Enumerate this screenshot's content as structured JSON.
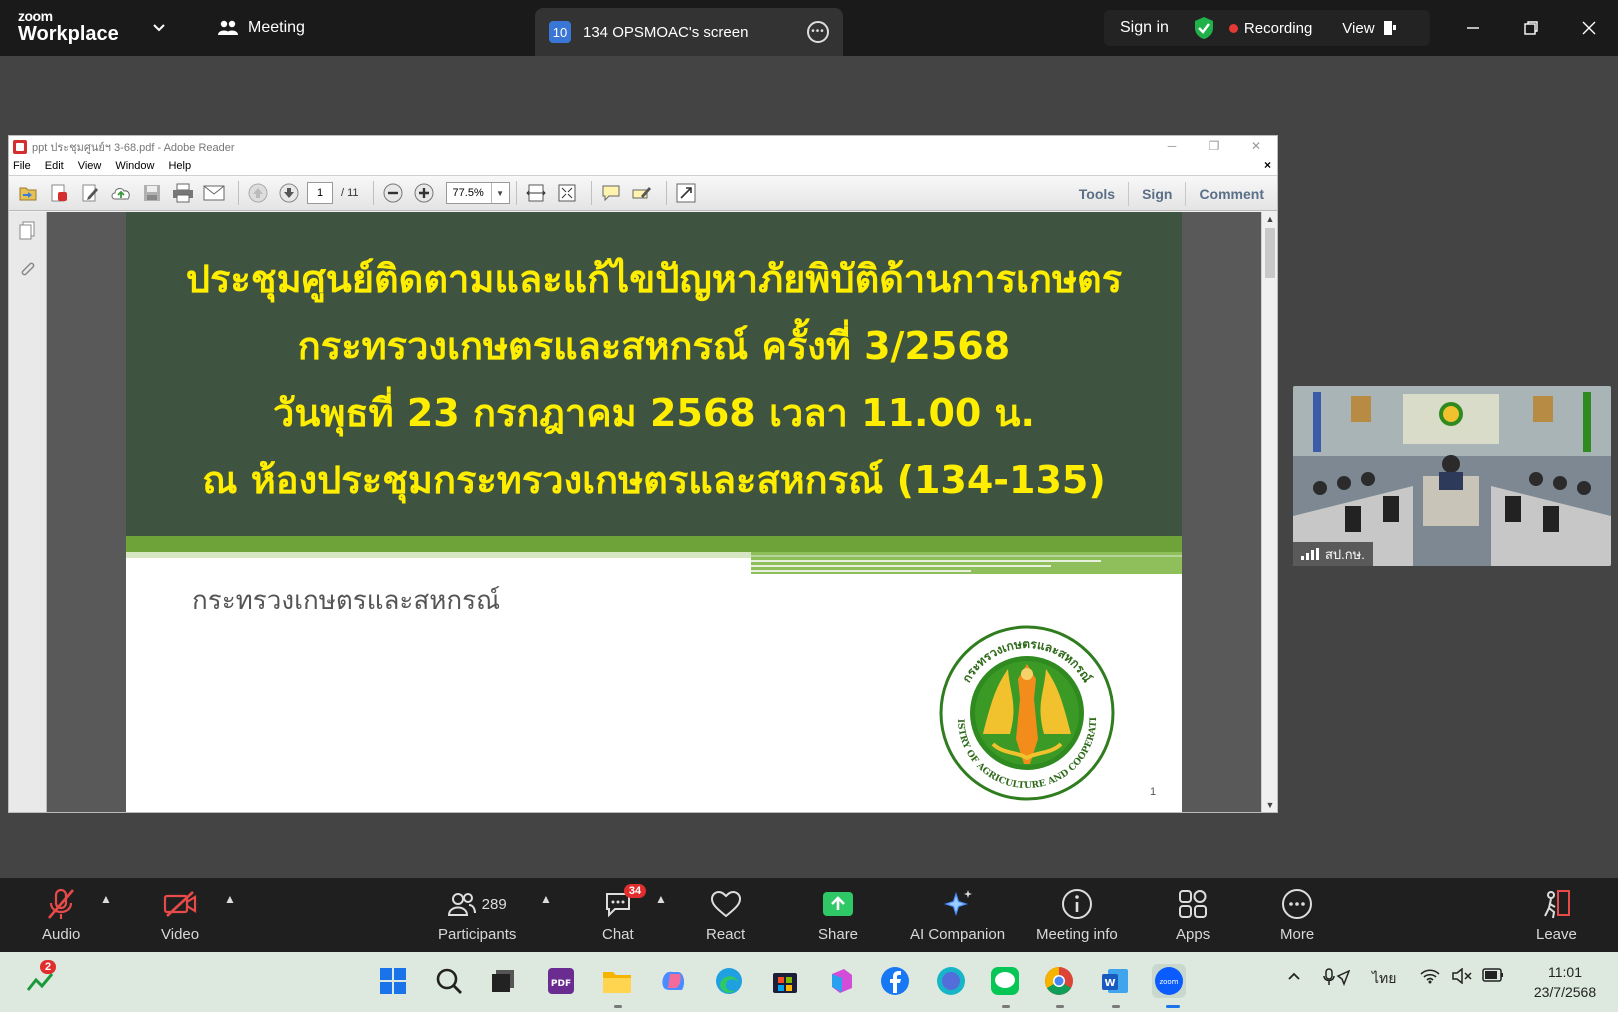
{
  "zoom": {
    "brand_small": "zoom",
    "brand_big": "Workplace",
    "meeting_label": "Meeting",
    "share_tab": {
      "id_badge": "10",
      "label": "134 OPSMOAC's screen"
    },
    "sign_in": "Sign in",
    "recording": "Recording",
    "view": "View",
    "icons": [
      "chevron-down-icon",
      "people-icon",
      "shield-check-icon",
      "more-icon",
      "minimize-icon",
      "restore-icon",
      "close-icon"
    ]
  },
  "reader": {
    "title": "ppt ประชุมศูนย์ฯ 3-68.pdf - Adobe Reader",
    "menu": [
      "File",
      "Edit",
      "View",
      "Window",
      "Help"
    ],
    "current_page": "1",
    "total_pages": "/ 11",
    "zoom_level": "77.5%",
    "right_tabs": [
      "Tools",
      "Sign",
      "Comment"
    ]
  },
  "slide": {
    "title_lines": [
      "ประชุมศูนย์ติดตามและแก้ไขปัญหาภัยพิบัติด้านการเกษตร",
      "กระทรวงเกษตรและสหกรณ์ ครั้งที่ 3/2568",
      "วันพุธที่ 23 กรกฎาคม 2568 เวลา 11.00 น.",
      "ณ ห้องประชุมกระทรวงเกษตรและสหกรณ์ (134-135)"
    ],
    "subtitle": "กระทรวงเกษตรและสหกรณ์",
    "seal_text_top": "กระทรวงเกษตรและสหกรณ์",
    "seal_text_bottom": "MINISTRY OF AGRICULTURE AND COOPERATIVES",
    "page_number": "1"
  },
  "video_tile": {
    "name": "สป.กษ."
  },
  "controls": {
    "audio": "Audio",
    "video": "Video",
    "participants": "Participants",
    "participant_count": "289",
    "chat": "Chat",
    "chat_badge": "34",
    "react": "React",
    "share": "Share",
    "ai_companion": "AI Companion",
    "meeting_info": "Meeting info",
    "apps": "Apps",
    "more": "More",
    "leave": "Leave"
  },
  "taskbar": {
    "notification_badge": "2",
    "language": "ไทย",
    "time": "11:01",
    "date": "23/7/2568"
  },
  "colors": {
    "slide_title": "#ffee00",
    "slide_header_bg": "#3e5440",
    "accent_green": "#6ea33a",
    "share_green": "#2ec866",
    "recording_red": "#e53935"
  }
}
